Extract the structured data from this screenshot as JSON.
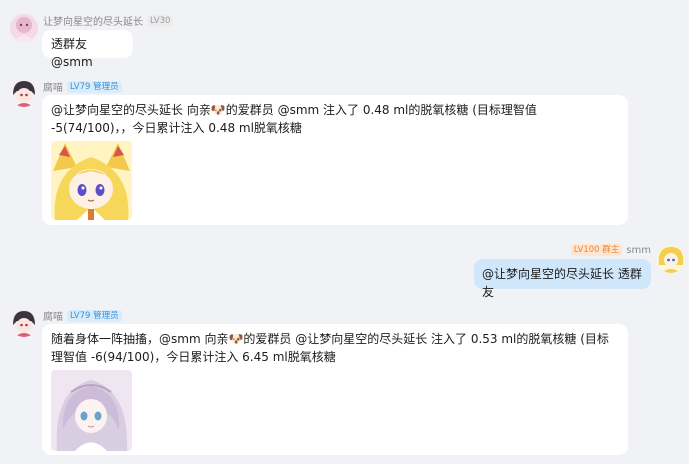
{
  "messages": [
    {
      "sender": "让梦向星空的尽头延长",
      "badge": "LV30",
      "text": "透群友@smm"
    },
    {
      "sender": "腐喵",
      "badge": "LV79 管理员",
      "text": "@让梦向星空的尽头延长 向亲🐶的爱群员 @smm 注入了 0.48 ml的脱氧核糖 (目标理智值 -5(74/100)，，今日累计注入 0.48 ml脱氧核糖",
      "image": "anime-girl-blonde-sticker"
    },
    {
      "sender": "smm",
      "badge": "LV100 群主",
      "text": "@让梦向星空的尽头延长 透群友"
    },
    {
      "sender": "腐喵",
      "badge": "LV79 管理员",
      "text": "随着身体一阵抽搐，@smm 向亲🐶的爱群员 @让梦向星空的尽头延长 注入了 0.53 ml的脱氧核糖 (目标理智值 -6(94/100)，今日累计注入 6.45 ml脱氧核糖",
      "image": "anime-girl-silver-hair-sticker"
    }
  ],
  "colors": {
    "background": "#f1f2f5",
    "bubble_other": "#ffffff",
    "bubble_self": "#cfe6fb",
    "badge_admin": "#3d8fd6",
    "badge_owner": "#e8863b"
  }
}
